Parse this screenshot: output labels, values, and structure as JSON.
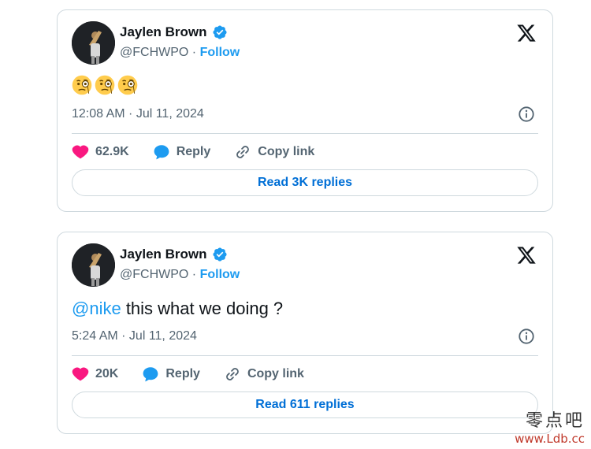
{
  "tweets": [
    {
      "author_name": "Jaylen Brown",
      "handle": "@FCHWPO",
      "separator": "·",
      "follow_label": "Follow",
      "body_emoji": [
        "face-with-monocle-emoji",
        "face-with-monocle-emoji",
        "face-with-monocle-emoji"
      ],
      "timestamp": "12:08 AM · Jul 11, 2024",
      "likes": "62.9K",
      "reply_label": "Reply",
      "copy_link_label": "Copy link",
      "read_replies_label": "Read 3K replies"
    },
    {
      "author_name": "Jaylen Brown",
      "handle": "@FCHWPO",
      "separator": "·",
      "follow_label": "Follow",
      "mention": "@nike",
      "body_text": " this what we doing ?",
      "timestamp": "5:24 AM · Jul 11, 2024",
      "likes": "20K",
      "reply_label": "Reply",
      "copy_link_label": "Copy link",
      "read_replies_label": "Read 611 replies"
    }
  ],
  "watermark": {
    "chinese": "零点吧",
    "url": "www.Ldb.cc"
  },
  "colors": {
    "accent_blue": "#1d9bf0",
    "like_pink": "#f91880",
    "text_secondary": "#536471",
    "border": "#cfd9de"
  }
}
